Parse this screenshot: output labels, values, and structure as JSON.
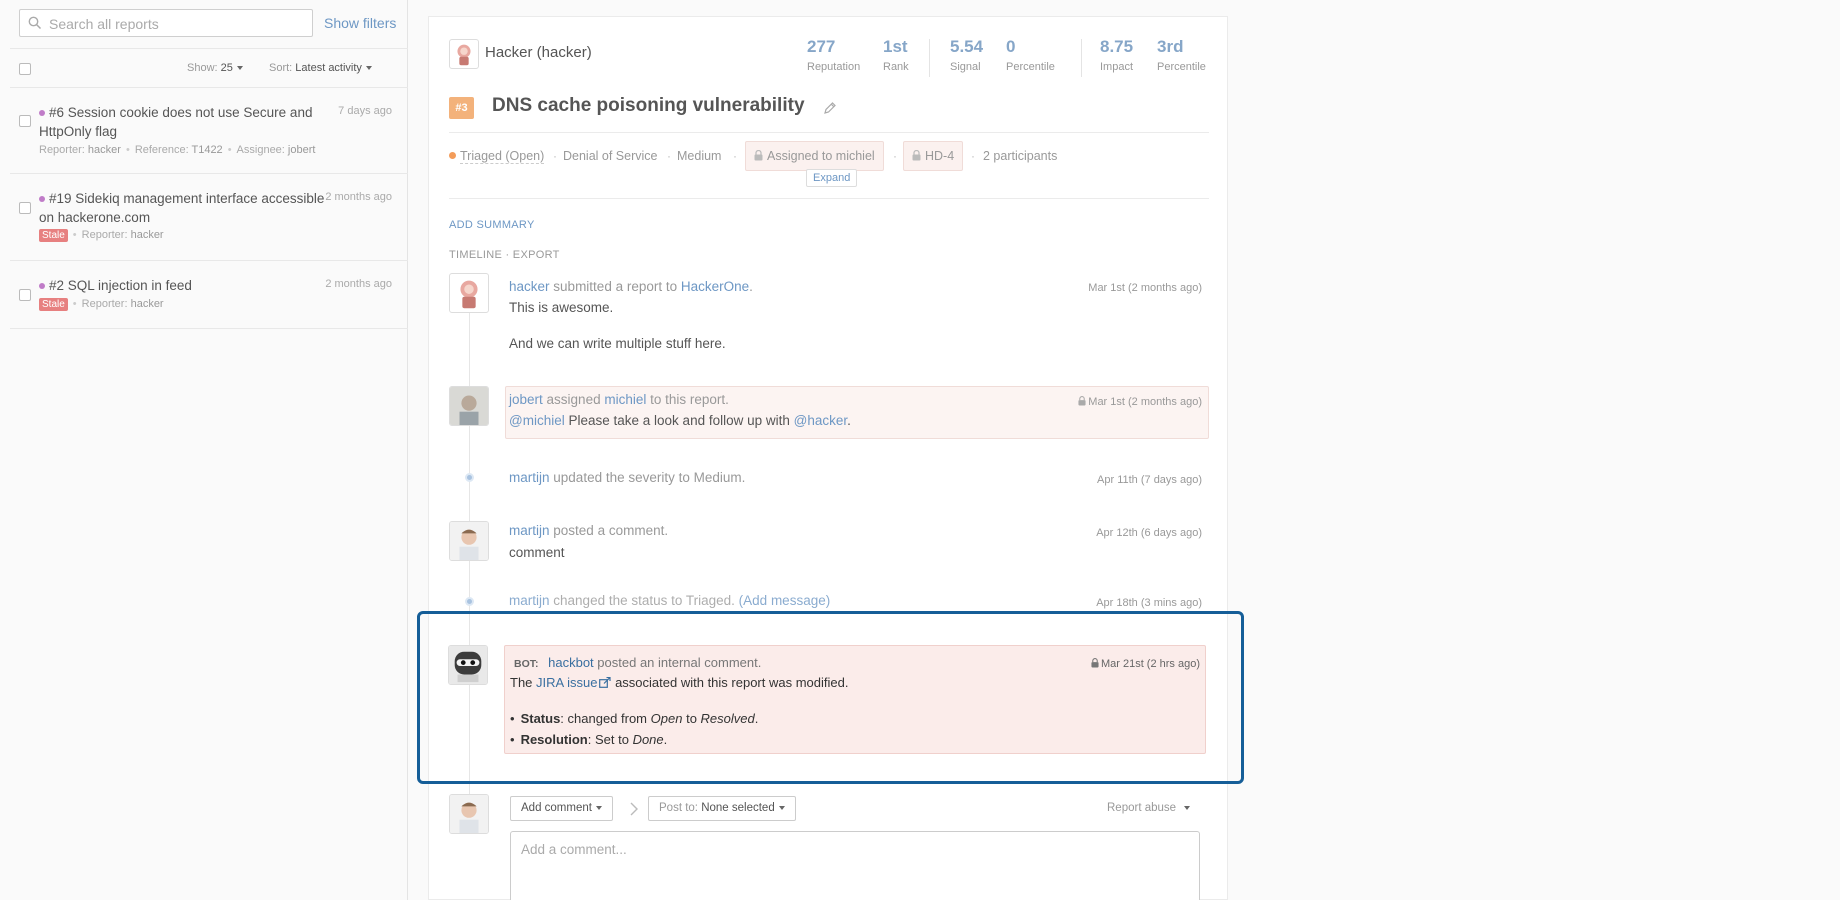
{
  "search": {
    "placeholder": "Search all reports",
    "show_filters": "Show filters"
  },
  "toolbar": {
    "show_label": "Show:",
    "show_value": "25",
    "sort_label": "Sort:",
    "sort_value": "Latest activity"
  },
  "reports": [
    {
      "id": "#6",
      "title": "Session cookie does not use Secure and HttpOnly flag",
      "time": "7 days ago",
      "reporter_label": "Reporter:",
      "reporter": "hacker",
      "reference_label": "Reference:",
      "reference": "T1422",
      "assignee_label": "Assignee:",
      "assignee": "jobert"
    },
    {
      "id": "#19",
      "title": "Sidekiq management interface accessible on hackerone.com",
      "time": "2 months ago",
      "badge": "Stale",
      "reporter_label": "Reporter:",
      "reporter": "hacker"
    },
    {
      "id": "#2",
      "title": "SQL injection in feed",
      "time": "2 months ago",
      "badge": "Stale",
      "reporter_label": "Reporter:",
      "reporter": "hacker"
    }
  ],
  "header": {
    "user": "Hacker (hacker)",
    "stats": [
      {
        "value": "277",
        "label": "Reputation"
      },
      {
        "value": "1st",
        "label": "Rank"
      },
      {
        "value": "5.54",
        "label": "Signal"
      },
      {
        "value": "0",
        "label": "Percentile"
      },
      {
        "value": "8.75",
        "label": "Impact"
      },
      {
        "value": "3rd",
        "label": "Percentile"
      }
    ]
  },
  "report": {
    "id": "#3",
    "title": "DNS cache poisoning vulnerability",
    "state": "Triaged (Open)",
    "weakness": "Denial of Service",
    "severity": "Medium",
    "assigned": "Assigned to michiel",
    "issue": "HD-4",
    "participants": "2 participants",
    "expand": "Expand",
    "sep": "·"
  },
  "labels": {
    "add_summary": "ADD SUMMARY",
    "timeline": "TIMELINE · EXPORT"
  },
  "timeline": {
    "e1": {
      "actor": "hacker",
      "action": "submitted a report to",
      "target": "HackerOne",
      "end": ".",
      "time": "Mar 1st (2 months ago)",
      "line1": "This is awesome.",
      "line2": "And we can write multiple stuff here."
    },
    "e2": {
      "actor": "jobert",
      "action": "assigned",
      "target": "michiel",
      "end": "to this report.",
      "time": "Mar 1st (2 months ago)",
      "mention1": "@michiel",
      "body": "Please take a look and follow up with",
      "mention2": "@hacker",
      "period": "."
    },
    "e3": {
      "actor": "martijn",
      "text": "updated the severity to Medium.",
      "time": "Apr 11th (7 days ago)"
    },
    "e4": {
      "actor": "martijn",
      "text": "posted a comment.",
      "time": "Apr 12th (6 days ago)",
      "body": "comment"
    },
    "e5": {
      "actor": "martijn",
      "text": "changed the status to Triaged.",
      "link": "(Add message)",
      "time": "Apr 18th (3 mins ago)"
    },
    "e6": {
      "prefix": "BOT:",
      "actor": "hackbot",
      "text": "posted an internal comment.",
      "time": "Mar 21st (2 hrs ago)",
      "line_pre": "The",
      "link": "JIRA issue",
      "line_post": "associated with this report was modified.",
      "b1_label": "Status",
      "b1_text": ": changed from",
      "b1_from": "Open",
      "b1_mid": "to",
      "b1_to": "Resolved",
      "b1_end": ".",
      "b2_label": "Resolution",
      "b2_text": ": Set to",
      "b2_val": "Done",
      "b2_end": "."
    }
  },
  "composer": {
    "add_comment": "Add comment",
    "post_to_label": "Post to:",
    "post_to_value": "None selected",
    "report_abuse": "Report abuse",
    "placeholder": "Add a comment..."
  },
  "colors": {
    "accent": "#6d97c4",
    "highlight": "#155e98",
    "stale": "#e78080",
    "triaged": "#f39c5a"
  }
}
